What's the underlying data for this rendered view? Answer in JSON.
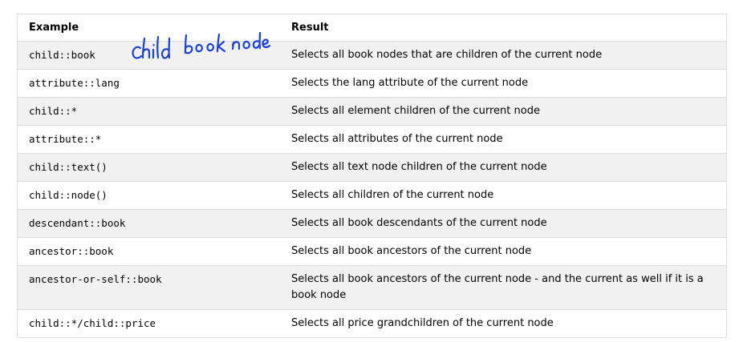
{
  "table": {
    "headers": {
      "example": "Example",
      "result": "Result"
    },
    "rows": [
      {
        "example": "child::book",
        "result": "Selects all book nodes that are children of the current node"
      },
      {
        "example": "attribute::lang",
        "result": "Selects the lang attribute of the current node"
      },
      {
        "example": "child::*",
        "result": "Selects all element children of the current node"
      },
      {
        "example": "attribute::*",
        "result": "Selects all attributes of the current node"
      },
      {
        "example": "child::text()",
        "result": "Selects all text node children of the current node"
      },
      {
        "example": "child::node()",
        "result": "Selects all children of the current node"
      },
      {
        "example": "descendant::book",
        "result": "Selects all book descendants of the current node"
      },
      {
        "example": "ancestor::book",
        "result": "Selects all book ancestors of the current node"
      },
      {
        "example": "ancestor-or-self::book",
        "result": "Selects all book ancestors of the current node - and the current as well if it is a book node"
      },
      {
        "example": "child::*/child::price",
        "result": "Selects all price grandchildren of the current node"
      }
    ]
  },
  "annotation": {
    "text": "child book node",
    "color": "#1a3fd6"
  }
}
